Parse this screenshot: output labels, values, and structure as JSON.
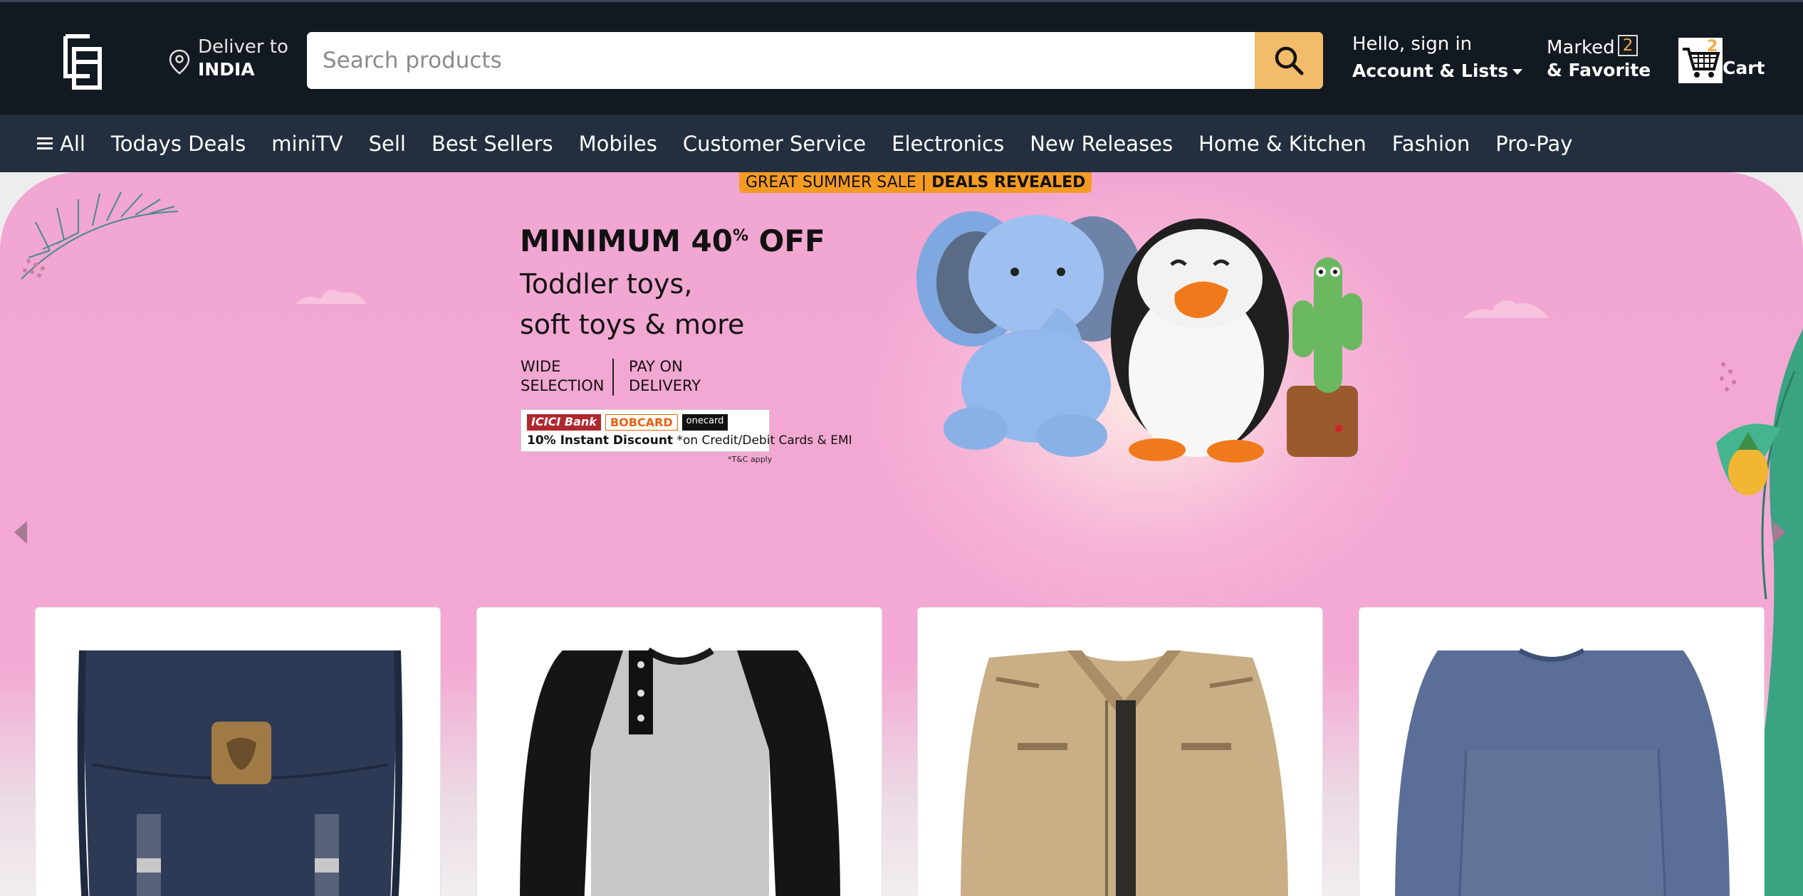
{
  "header": {
    "deliver_label": "Deliver to",
    "deliver_location": "INDIA",
    "search_placeholder": "Search products",
    "search_value": "",
    "greeting": "Hello, sign in",
    "account_label": "Account & Lists",
    "marked_label": "Marked",
    "marked_count": "2",
    "favorite_label": "& Favorite",
    "cart_count": "2",
    "cart_label": "Cart"
  },
  "nav": {
    "all_label": "All",
    "items": [
      "Todays Deals",
      "miniTV",
      "Sell",
      "Best Sellers",
      "Mobiles",
      "Customer Service",
      "Electronics",
      "New Releases",
      "Home & Kitchen",
      "Fashion",
      "Pro-Pay"
    ]
  },
  "hero": {
    "sale_tag_prefix": "GREAT SUMMER SALE | ",
    "sale_tag_bold": "DEALS REVEALED",
    "offer_prefix": "MINIMUM 40",
    "offer_sup": "%",
    "offer_suffix": " OFF",
    "line1": "Toddler toys,",
    "line2": "soft toys & more",
    "feature1_a": "WIDE",
    "feature1_b": "SELECTION",
    "feature2_a": "PAY ON",
    "feature2_b": "DELIVERY",
    "bank1": "ICICI Bank",
    "bank2": "BOBCARD",
    "bank3": "onecard",
    "discount_bold": "10% Instant Discount",
    "discount_rest": "*on Credit/Debit Cards & EMI",
    "tnc": "*T&C apply"
  },
  "products": [
    {
      "name": "Backpack",
      "icon": "backpack"
    },
    {
      "name": "Raglan henley shirt",
      "icon": "shirt"
    },
    {
      "name": "Khaki jacket",
      "icon": "jacket"
    },
    {
      "name": "Long sleeve t-shirt",
      "icon": "sweater"
    }
  ],
  "colors": {
    "header_bg": "#131921",
    "nav_bg": "#232f3e",
    "search_button": "#f3bc6a",
    "hero_bg": "#f4a9d4",
    "accent_orange": "#f59b24"
  }
}
